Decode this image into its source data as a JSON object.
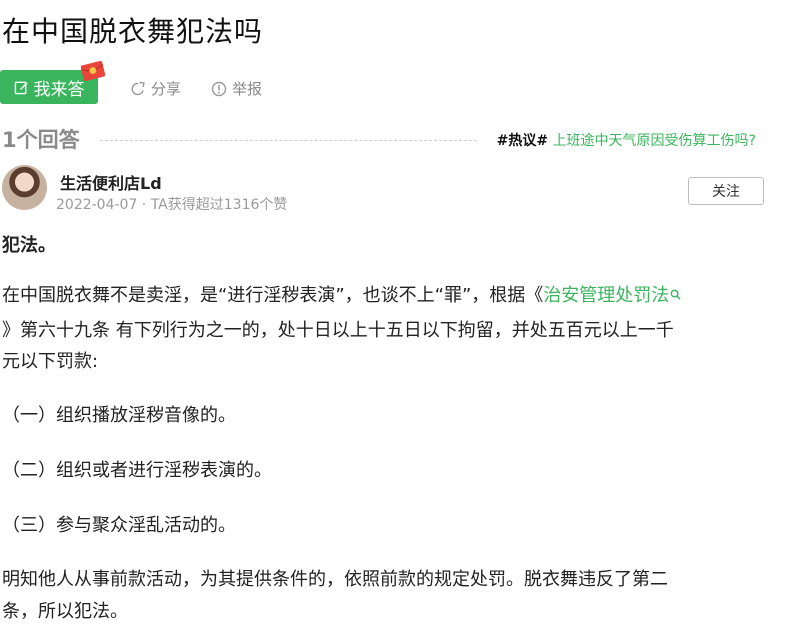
{
  "question": {
    "title": "在中国脱衣舞犯法吗"
  },
  "actions": {
    "answer_label": "我来答",
    "share_label": "分享",
    "report_label": "举报"
  },
  "answers_header": {
    "count_label": "1个回答",
    "hot_tag": "#热议#",
    "hot_topic": "上班途中天气原因受伤算工伤吗?"
  },
  "answer": {
    "author_name": "生活便利店Ld",
    "meta": "2022-04-07 · TA获得超过1316个赞",
    "follow_label": "关注",
    "verdict": "犯法。",
    "para1_line1_before": "在中国脱衣舞不是卖淫，是“进行淫秽表演”，也谈不上“罪”，根据《",
    "law_name": "治安管理处罚法",
    "para1_line2": "》第六十九条 有下列行为之一的，处十日以上十五日以下拘留，并处五百元以上一千",
    "para1_line3": "元以下罚款:",
    "item1": "（一）组织播放淫秽音像的。",
    "item2": "（二）组织或者进行淫秽表演的。",
    "item3": "（三）参与聚众淫乱活动的。",
    "conclusion_line1": "明知他人从事前款活动，为其提供条件的，依照前款的规定处罚。脱衣舞违反了第二",
    "conclusion_line2": "条，所以犯法。"
  },
  "colors": {
    "accent": "#3bb55d",
    "muted": "#8a8a8a"
  },
  "icons": [
    "edit-icon",
    "red-packet-icon",
    "share-icon",
    "report-icon",
    "search-icon"
  ]
}
